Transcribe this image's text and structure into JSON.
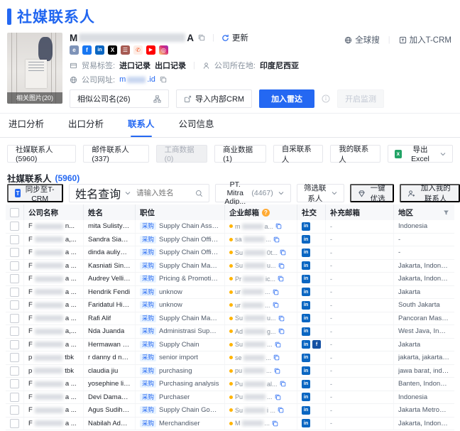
{
  "page": {
    "title": "社媒联系人"
  },
  "colors": {
    "accent": "#2468F2",
    "linkedin": "#0A66C2",
    "facebook": "#1877F2",
    "tag_bg": "#E8F3FF",
    "email_dot": "#FFB400",
    "excel_green": "#21A366"
  },
  "header": {
    "photo_label": "相关图片(20)",
    "company_name_prefix": "M",
    "company_name_suffix": "A",
    "update_label": "更新",
    "global_search_label": "全球搜",
    "join_tcrm_label": "加入T-CRM",
    "social_icons": [
      "website-icon",
      "facebook-icon",
      "linkedin-icon",
      "x-icon",
      "address-book-icon",
      "phone-icon",
      "youtube-icon",
      "instagram-icon"
    ],
    "trade_label": "贸易标签:",
    "trade_tag_import": "进口记录",
    "trade_tag_export": "出口记录",
    "location_label": "公司所在地:",
    "location_value": "印度尼西亚",
    "website_label": "公司网址:",
    "website_prefix": "m",
    "website_suffix": ".id",
    "similar_companies_label": "相似公司名(26)",
    "import_crm_label": "导入内部CRM",
    "join_radar_label": "加入雷达",
    "monitor_label": "开启监测"
  },
  "tabs": [
    {
      "label": "进口分析"
    },
    {
      "label": "出口分析"
    },
    {
      "label": "联系人"
    },
    {
      "label": "公司信息"
    }
  ],
  "pills": [
    {
      "label": "社媒联系人(5960)"
    },
    {
      "label": "邮件联系人(337)"
    },
    {
      "label": "工商数据(0)"
    },
    {
      "label": "商业数据(1)"
    },
    {
      "label": "自采联系人"
    },
    {
      "label": "我的联系人"
    }
  ],
  "export_label": "导出 Excel",
  "section": {
    "title": "社媒联系人",
    "count": "(5960)"
  },
  "toolbar": {
    "sync_label": "同步至T-CRM",
    "name_query_label": "姓名查询",
    "search_placeholder": "请输入姓名",
    "company_filter_label": "PT. Mitra Adip...",
    "company_filter_count": "(4467)",
    "filter_contacts_label": "筛选联系人",
    "optimize_label": "一键优选",
    "add_contacts_label": "加入我的联系人"
  },
  "table": {
    "columns": [
      "公司名称",
      "姓名",
      "职位",
      "企业邮箱",
      "社交",
      "补充邮箱",
      "地区"
    ],
    "tag_label": "采购",
    "rows": [
      {
        "company_prefix": "F",
        "company_suffix": "n...",
        "name": "mita Sulistyandari",
        "position": "Supply Chain Assistant Man...",
        "email_prefix": "m",
        "email_suffix": "a...",
        "social": [
          "linkedin"
        ],
        "extra_email": "-",
        "region": "Indonesia"
      },
      {
        "company_prefix": "F",
        "company_suffix": "a,...",
        "name": "Sandra Sianipar",
        "position": "Supply Chain Officer",
        "email_prefix": "sa",
        "email_suffix": "...",
        "social": [
          "linkedin"
        ],
        "extra_email": "-",
        "region": "-"
      },
      {
        "company_prefix": "F",
        "company_suffix": "a ...",
        "name": "dinda auliya adha",
        "position": "Supply Chain Officer",
        "email_prefix": "Su",
        "email_suffix": "0t...",
        "social": [
          "linkedin"
        ],
        "extra_email": "-",
        "region": "-"
      },
      {
        "company_prefix": "F",
        "company_suffix": "a ...",
        "name": "Kasniati Sinaga",
        "position": "Supply Chain Management",
        "email_prefix": "Su",
        "email_suffix": "u...",
        "social": [
          "linkedin"
        ],
        "extra_email": "-",
        "region": "Jakarta, Indonesia"
      },
      {
        "company_prefix": "F",
        "company_suffix": "a ...",
        "name": "Audrey Vellicia",
        "position": "Pricing & Promotion Execut...",
        "email_prefix": "Pr",
        "email_suffix": "ic...",
        "social": [
          "linkedin"
        ],
        "extra_email": "-",
        "region": "Jakarta, Indonesia"
      },
      {
        "company_prefix": "F",
        "company_suffix": "a ...",
        "name": "Hendrik Fendi",
        "position": "unknow",
        "email_prefix": "ur",
        "email_suffix": "...",
        "social": [
          "linkedin"
        ],
        "extra_email": "-",
        "region": "Jakarta"
      },
      {
        "company_prefix": "F",
        "company_suffix": "a ...",
        "name": "Faridatul Hidzroh",
        "position": "unknow",
        "email_prefix": "ur",
        "email_suffix": "...",
        "social": [
          "linkedin"
        ],
        "extra_email": "-",
        "region": "South Jakarta"
      },
      {
        "company_prefix": "F",
        "company_suffix": "a ...",
        "name": "Rafi Alif",
        "position": "Supply Chain Management ...",
        "email_prefix": "Su",
        "email_suffix": "u...",
        "social": [
          "linkedin"
        ],
        "extra_email": "-",
        "region": "Pancoran Mas, ..."
      },
      {
        "company_prefix": "F",
        "company_suffix": "a,...",
        "name": "Nda Juanda",
        "position": "Administrasi Supply Chain (...",
        "email_prefix": "Ad",
        "email_suffix": "g...",
        "social": [
          "linkedin"
        ],
        "extra_email": "-",
        "region": "West Java, Indo..."
      },
      {
        "company_prefix": "F",
        "company_suffix": "a ...",
        "name": "Hermawan Sapu...",
        "position": "Supply Chain",
        "email_prefix": "Su",
        "email_suffix": "...",
        "social": [
          "linkedin",
          "facebook"
        ],
        "extra_email": "-",
        "region": "Jakarta"
      },
      {
        "company_prefix": "p",
        "company_suffix": "tbk",
        "name": "r danny d nurpat...",
        "position": "senior import",
        "email_prefix": "se",
        "email_suffix": "...",
        "social": [
          "linkedin"
        ],
        "extra_email": "-",
        "region": "jakarta, jakarta r..."
      },
      {
        "company_prefix": "p",
        "company_suffix": "tbk",
        "name": "claudia jiu",
        "position": "purchasing",
        "email_prefix": "pu",
        "email_suffix": "...",
        "social": [
          "linkedin"
        ],
        "extra_email": "-",
        "region": "jawa barat, indo..."
      },
      {
        "company_prefix": "F",
        "company_suffix": "a ...",
        "name": "yosephine liviane",
        "position": "Purchasing analysis",
        "email_prefix": "Pu",
        "email_suffix": "al...",
        "social": [
          "linkedin"
        ],
        "extra_email": "-",
        "region": "Banten, Indonesia"
      },
      {
        "company_prefix": "F",
        "company_suffix": "a ...",
        "name": "Devi Damayanti",
        "position": "Purchaser",
        "email_prefix": "Pu",
        "email_suffix": "...",
        "social": [
          "linkedin"
        ],
        "extra_email": "-",
        "region": "Indonesia"
      },
      {
        "company_prefix": "F",
        "company_suffix": "a ...",
        "name": "Agus Sudiharjo",
        "position": "Supply Chain Governance In...",
        "email_prefix": "Su",
        "email_suffix": "i ...",
        "social": [
          "linkedin"
        ],
        "extra_email": "-",
        "region": "Jakarta Metropo..."
      },
      {
        "company_prefix": "F",
        "company_suffix": "a ...",
        "name": "Nabilah Adellia",
        "position": "Merchandiser",
        "email_prefix": "M",
        "email_suffix": "...",
        "social": [
          "linkedin"
        ],
        "extra_email": "-",
        "region": "Jakarta, Indonesia"
      }
    ]
  }
}
